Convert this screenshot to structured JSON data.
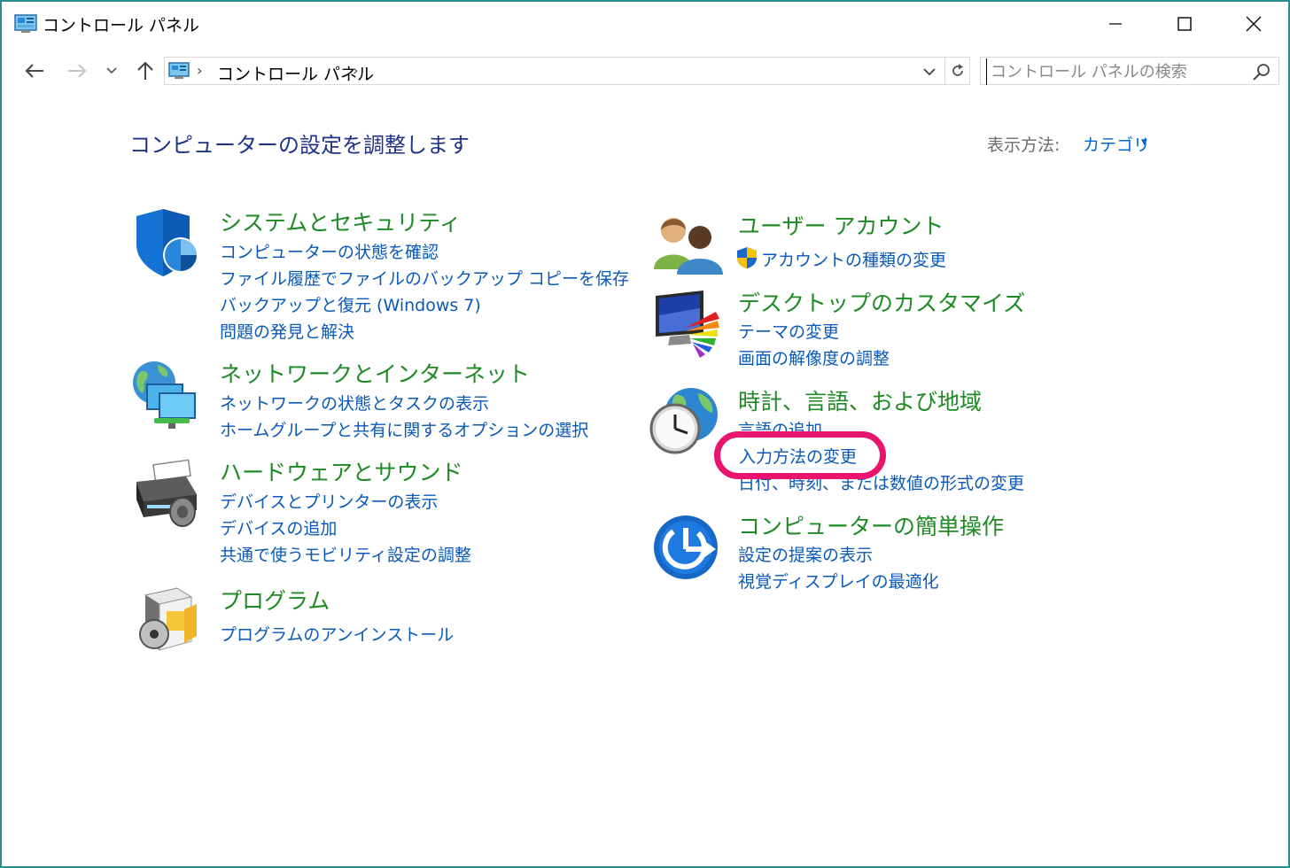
{
  "window": {
    "title": "コントロール パネル"
  },
  "navigation": {
    "breadcrumb": "コントロール パネル",
    "search_placeholder": "コントロール パネルの検索"
  },
  "header": {
    "title": "コンピューターの設定を調整します",
    "view_label": "表示方法:",
    "view_value": "カテゴリ"
  },
  "categories": {
    "system": {
      "title": "システムとセキュリティ",
      "icon": "shield-icon",
      "links": [
        "コンピューターの状態を確認",
        "ファイル履歴でファイルのバックアップ コピーを保存",
        "バックアップと復元 (Windows 7)",
        "問題の発見と解決"
      ]
    },
    "network": {
      "title": "ネットワークとインターネット",
      "icon": "network-icon",
      "links": [
        "ネットワークの状態とタスクの表示",
        "ホームグループと共有に関するオプションの選択"
      ]
    },
    "hardware": {
      "title": "ハードウェアとサウンド",
      "icon": "printer-icon",
      "links": [
        "デバイスとプリンターの表示",
        "デバイスの追加",
        "共通で使うモビリティ設定の調整"
      ]
    },
    "programs": {
      "title": "プログラム",
      "icon": "programs-icon",
      "links": [
        "プログラムのアンインストール"
      ]
    },
    "users": {
      "title": "ユーザー アカウント",
      "icon": "users-icon",
      "links": [
        "アカウントの種類の変更"
      ]
    },
    "desktop": {
      "title": "デスクトップのカスタマイズ",
      "icon": "desktop-icon",
      "links": [
        "テーマの変更",
        "画面の解像度の調整"
      ]
    },
    "clock": {
      "title": "時計、言語、および地域",
      "icon": "clock-globe-icon",
      "links": [
        "言語の追加",
        "入力方法の変更",
        "日付、時刻、または数値の形式の変更"
      ]
    },
    "access": {
      "title": "コンピューターの簡単操作",
      "icon": "ease-of-access-icon",
      "links": [
        "設定の提案の表示",
        "視覚ディスプレイの最適化"
      ]
    }
  },
  "colors": {
    "category_title": "#1e8a23",
    "link": "#0a58b8",
    "page_title": "#1e3287",
    "highlight": "#e8146e",
    "window_border": "#2b8d8d"
  }
}
